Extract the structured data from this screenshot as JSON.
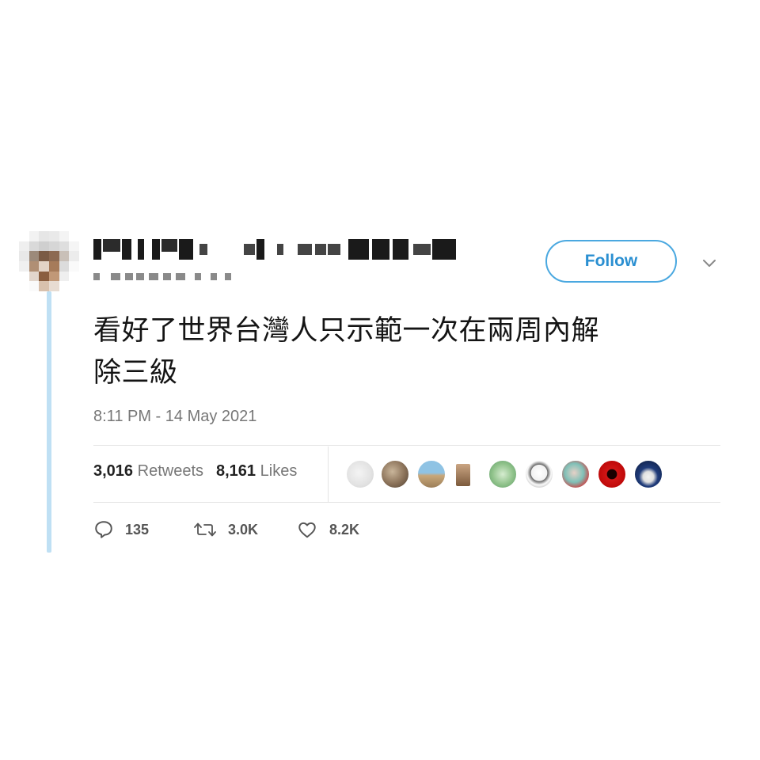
{
  "author": {
    "display_name": "",
    "handle": ""
  },
  "follow_label": "Follow",
  "tweet": {
    "text_line1": "看好了世界台灣人只示範一次在兩周內解",
    "text_line2": "除三級",
    "timestamp": "8:11 PM - 14 May 2021"
  },
  "stats": {
    "retweets_count": "3,016",
    "retweets_label": "Retweets",
    "likes_count": "8,161",
    "likes_label": "Likes"
  },
  "actions": {
    "replies": "135",
    "retweets": "3.0K",
    "likes": "8.2K"
  },
  "colors": {
    "accent": "#4aa8e0",
    "thread_line": "#bfe0f4",
    "text": "#141414",
    "muted": "#777777"
  },
  "icons": {
    "reply": "speech-bubble-icon",
    "retweet": "retweet-arrows-icon",
    "like": "heart-icon",
    "more": "chevron-down-icon"
  }
}
